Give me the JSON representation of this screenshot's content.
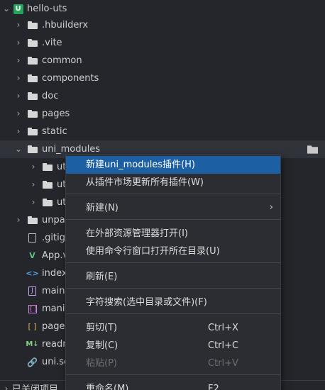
{
  "explorer": {
    "root": "hello-uts",
    "root_badge": "U",
    "items": [
      {
        "label": ".hbuilderx"
      },
      {
        "label": ".vite"
      },
      {
        "label": "common"
      },
      {
        "label": "components"
      },
      {
        "label": "doc"
      },
      {
        "label": "pages"
      },
      {
        "label": "static"
      },
      {
        "label": "uni_modules"
      },
      {
        "label": "ut"
      },
      {
        "label": "ut"
      },
      {
        "label": "ut"
      },
      {
        "label": "unpac"
      },
      {
        "label": ".gitigr"
      },
      {
        "label": "App.v"
      },
      {
        "label": "index."
      },
      {
        "label": "main.j"
      },
      {
        "label": "manif"
      },
      {
        "label": "pages"
      },
      {
        "label": "readm"
      },
      {
        "label": "uni.sc"
      }
    ],
    "icons": {
      "vue": "V",
      "html": "<>",
      "js": "J",
      "manifest": "{ }",
      "json": "[ ]",
      "markdown": "M↓",
      "link": "🔗"
    },
    "closed_section": "已关闭项目"
  },
  "context_menu": {
    "items": [
      {
        "label": "新建uni_modules插件(H)",
        "shortcut": ""
      },
      {
        "label": "从插件市场更新所有插件(W)",
        "shortcut": ""
      },
      {
        "label": "新建(N)",
        "shortcut": ""
      },
      {
        "label": "在外部资源管理器打开(I)",
        "shortcut": ""
      },
      {
        "label": "使用命令行窗口打开所在目录(U)",
        "shortcut": ""
      },
      {
        "label": "刷新(E)",
        "shortcut": ""
      },
      {
        "label": "字符搜索(选中目录或文件)(F)",
        "shortcut": ""
      },
      {
        "label": "剪切(T)",
        "shortcut": "Ctrl+X"
      },
      {
        "label": "复制(C)",
        "shortcut": "Ctrl+C"
      },
      {
        "label": "粘贴(P)",
        "shortcut": "Ctrl+V"
      },
      {
        "label": "重命名(M)",
        "shortcut": "F2"
      }
    ]
  },
  "colors": {
    "background": "#24262b",
    "menu_background": "#2b2d33",
    "menu_selected": "#1c5fa3",
    "project_badge": "#25a35a"
  }
}
